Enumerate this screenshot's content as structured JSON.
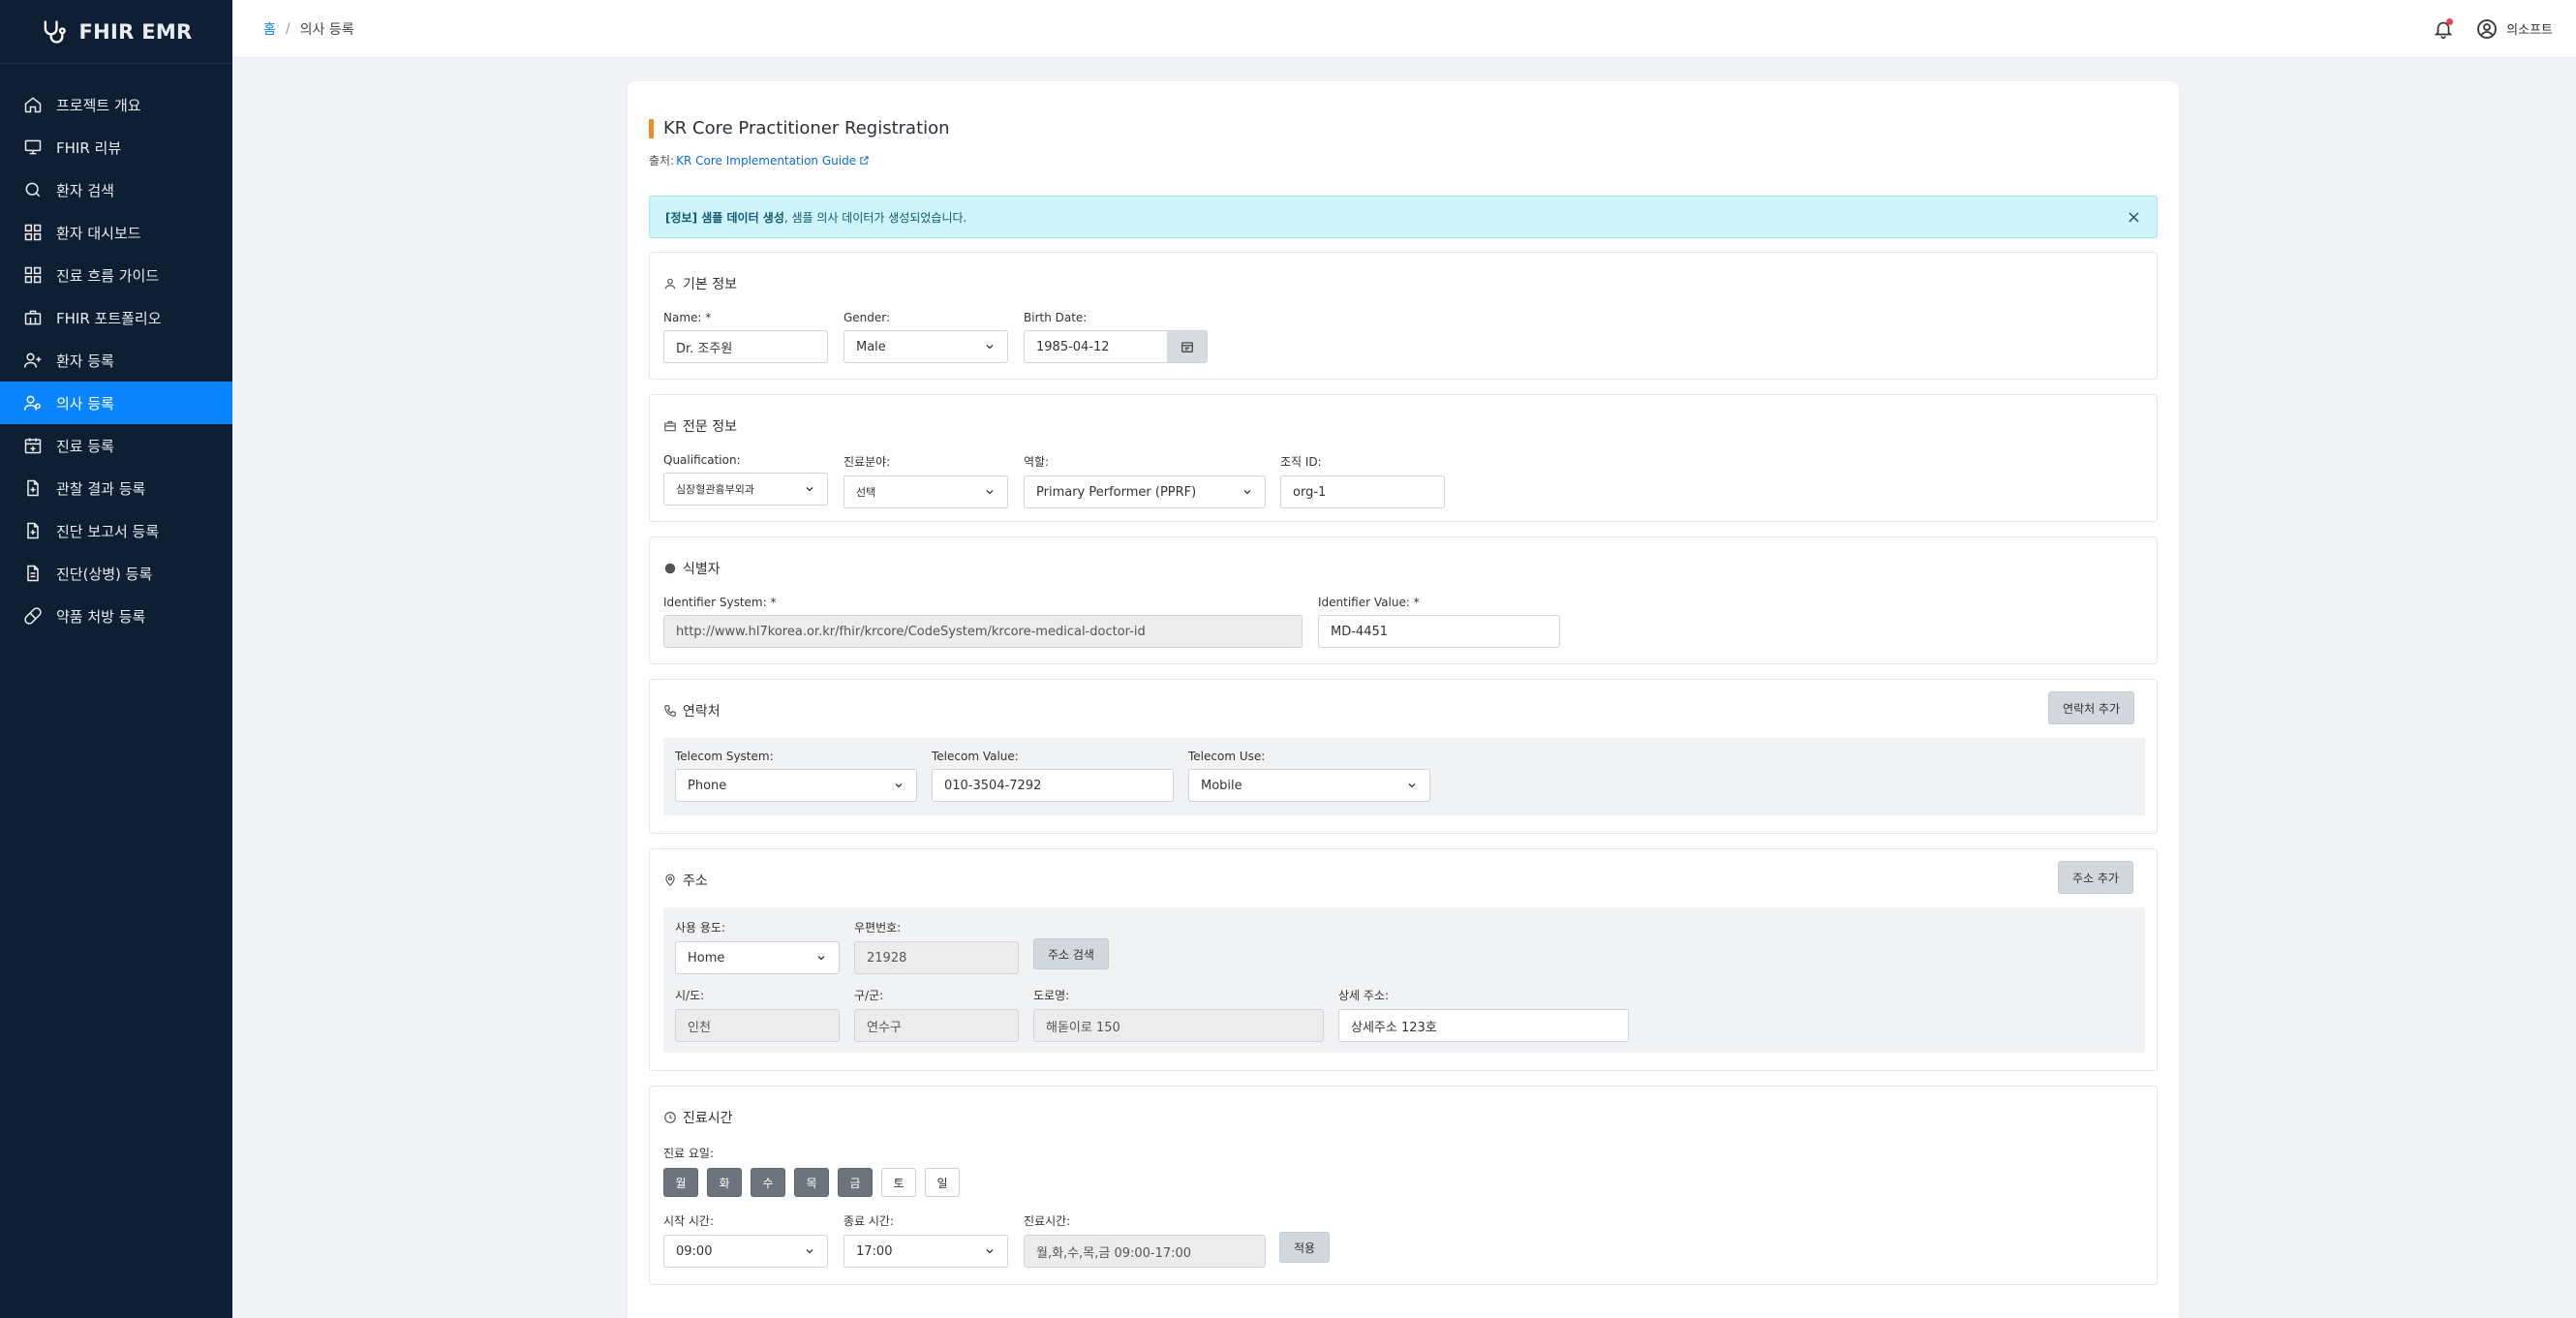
{
  "app": {
    "brand": "FHIR EMR"
  },
  "sidebar": {
    "items": [
      {
        "label": "프로젝트 개요",
        "icon": "home-icon"
      },
      {
        "label": "FHIR 리뷰",
        "icon": "monitor-icon"
      },
      {
        "label": "환자 검색",
        "icon": "search-icon"
      },
      {
        "label": "환자 대시보드",
        "icon": "dashboard-icon"
      },
      {
        "label": "진료 흐름 가이드",
        "icon": "grid-icon"
      },
      {
        "label": "FHIR 포트폴리오",
        "icon": "briefcase-icon"
      },
      {
        "label": "환자 등록",
        "icon": "user-plus-icon"
      },
      {
        "label": "의사 등록",
        "icon": "user-doctor-icon",
        "active": true
      },
      {
        "label": "진료 등록",
        "icon": "calendar-plus-icon"
      },
      {
        "label": "관찰 결과 등록",
        "icon": "file-plus-icon"
      },
      {
        "label": "진단 보고서 등록",
        "icon": "file-report-icon"
      },
      {
        "label": "진단(상병) 등록",
        "icon": "file-text-icon"
      },
      {
        "label": "약품 처방 등록",
        "icon": "pill-icon"
      }
    ]
  },
  "header": {
    "breadcrumb_home": "홈",
    "breadcrumb_sep": "/",
    "breadcrumb_current": "의사 등록",
    "user_name": "의소프트"
  },
  "page": {
    "title": "KR Core Practitioner Registration",
    "source_prefix": "출처:",
    "source_link": "KR Core Implementation Guide"
  },
  "alert": {
    "bold": "[정보] 샘플 데이터 생성",
    "text": ", 샘플 의사 데이터가 생성되었습니다.",
    "close": "×"
  },
  "basic": {
    "heading": "기본 정보",
    "name_label": "Name: *",
    "name_value": "Dr. 조주원",
    "gender_label": "Gender:",
    "gender_value": "Male",
    "birth_label": "Birth Date:",
    "birth_value": "1985-04-12"
  },
  "professional": {
    "heading": "전문 정보",
    "qualification_label": "Qualification:",
    "qualification_value": "심장혈관흉부외과",
    "specialty_label": "진료분야:",
    "specialty_value": "선택",
    "role_label": "역할:",
    "role_value": "Primary Performer (PPRF)",
    "org_label": "조직 ID:",
    "org_value": "org-1"
  },
  "identifier": {
    "heading": "식별자",
    "system_label": "Identifier System: *",
    "system_value": "http://www.hl7korea.or.kr/fhir/krcore/CodeSystem/krcore-medical-doctor-id",
    "value_label": "Identifier Value: *",
    "value_value": "MD-4451"
  },
  "contact": {
    "heading": "연락처",
    "add_button": "연락처 추가",
    "system_label": "Telecom System:",
    "system_value": "Phone",
    "value_label": "Telecom Value:",
    "value_value": "010-3504-7292",
    "use_label": "Telecom Use:",
    "use_value": "Mobile"
  },
  "address": {
    "heading": "주소",
    "add_button": "주소 추가",
    "use_label": "사용 용도:",
    "use_value": "Home",
    "postal_label": "우편번호:",
    "postal_value": "21928",
    "search_button": "주소 검색",
    "city_label": "시/도:",
    "city_value": "인천",
    "district_label": "구/군:",
    "district_value": "연수구",
    "road_label": "도로명:",
    "road_value": "해돋이로 150",
    "detail_label": "상세 주소:",
    "detail_value": "상세주소 123호"
  },
  "hours": {
    "heading": "진료시간",
    "days_label": "진료 요일:",
    "days": [
      {
        "label": "월",
        "on": true
      },
      {
        "label": "화",
        "on": true
      },
      {
        "label": "수",
        "on": true
      },
      {
        "label": "목",
        "on": true
      },
      {
        "label": "금",
        "on": true
      },
      {
        "label": "토",
        "on": false
      },
      {
        "label": "일",
        "on": false
      }
    ],
    "start_label": "시작 시간:",
    "start_value": "09:00",
    "end_label": "종료 시간:",
    "end_value": "17:00",
    "summary_label": "진료시간:",
    "summary_value": "월,화,수,목,금 09:00-17:00",
    "apply_button": "적용"
  },
  "colors": {
    "sidebar": "#0f1f33",
    "active": "#0a84ff",
    "accent": "#f28c28",
    "alert_bg": "#cdf3fb"
  }
}
